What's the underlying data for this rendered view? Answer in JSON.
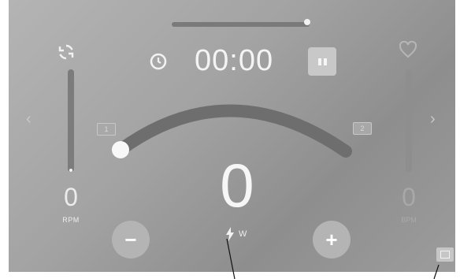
{
  "timer": {
    "value": "00:00"
  },
  "workout": {
    "progress": 0.98,
    "resistance_level": 0.0
  },
  "cadence": {
    "value": "0",
    "unit": "RPM"
  },
  "power": {
    "value": "0",
    "unit": "W"
  },
  "heart_rate": {
    "value": "0",
    "unit": "BPM"
  },
  "arc": {
    "left_badge": "1",
    "right_badge": "2"
  },
  "controls": {
    "decrease_label": "−",
    "increase_label": "+"
  },
  "nav": {
    "prev_glyph": "‹",
    "next_glyph": "›"
  },
  "icons": {
    "sync": "sync-icon",
    "timer": "clock-icon",
    "pause": "pause-icon",
    "heart": "heart-icon",
    "bolt": "lightning-icon",
    "corner": "fullscreen-icon"
  },
  "colors": {
    "accent": "#f4f4f4",
    "arc": "#6e6e6e",
    "background": "#a0a0a0"
  }
}
